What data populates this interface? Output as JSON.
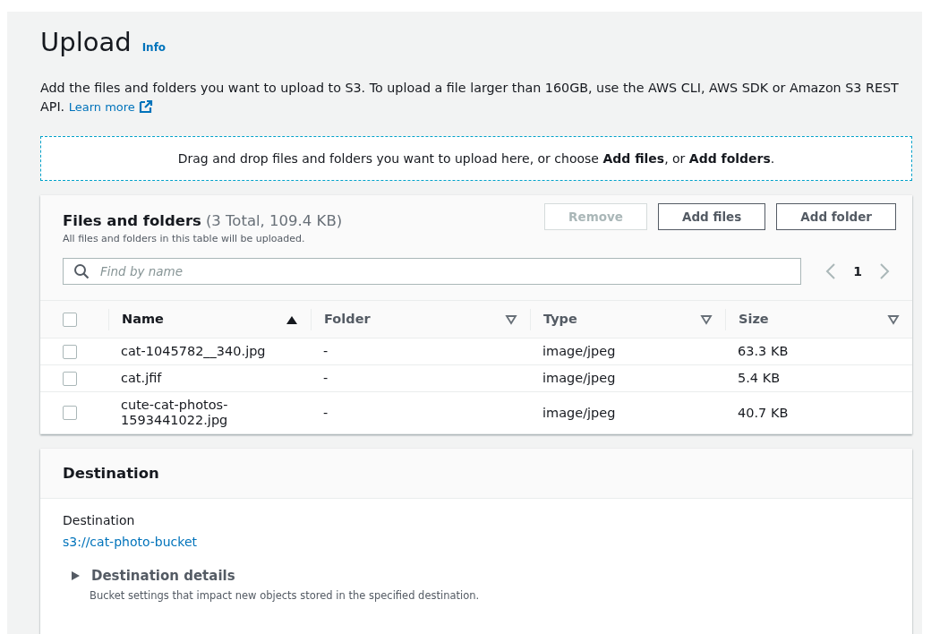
{
  "header": {
    "title": "Upload",
    "info_link": "Info"
  },
  "description": {
    "text": "Add the files and folders you want to upload to S3. To upload a file larger than 160GB, use the AWS CLI, AWS SDK or Amazon S3 REST API.",
    "link": "Learn more"
  },
  "dropzone": {
    "text": "Drag and drop files and folders you want to upload here, or choose **Add files**, or **Add folders**."
  },
  "files_panel": {
    "title": "Files and folders",
    "count": "(3 Total, 109.4 KB)",
    "subtitle": "All files and folders in this table will be uploaded.",
    "buttons": [
      {
        "label": "Remove",
        "disabled": true
      },
      {
        "label": "Add files",
        "disabled": false
      },
      {
        "label": "Add folder",
        "disabled": false
      }
    ],
    "search": {
      "placeholder": "Find by name"
    },
    "pagination": {
      "page": "1"
    },
    "table": {
      "select_all_checked": false,
      "columns": [
        {
          "label": "Name",
          "sorted": true
        },
        {
          "label": "Folder",
          "sorted": false
        },
        {
          "label": "Type",
          "sorted": false
        },
        {
          "label": "Size",
          "sorted": false
        }
      ],
      "rows": [
        {
          "checked": false,
          "cells": [
            "cat-1045782__340.jpg",
            "-",
            "image/jpeg",
            "63.3 KB"
          ]
        },
        {
          "checked": false,
          "cells": [
            "cat.jfif",
            "-",
            "image/jpeg",
            "5.4 KB"
          ]
        },
        {
          "checked": false,
          "cells": [
            "cute-cat-photos-1593441022.jpg",
            "-",
            "image/jpeg",
            "40.7 KB"
          ]
        }
      ]
    }
  },
  "destination_panel": {
    "title": "Destination",
    "label": "Destination",
    "value": "s3://cat-photo-bucket",
    "details": {
      "title": "Destination details",
      "expanded": false,
      "description": "Bucket settings that impact new objects stored in the specified destination."
    }
  }
}
